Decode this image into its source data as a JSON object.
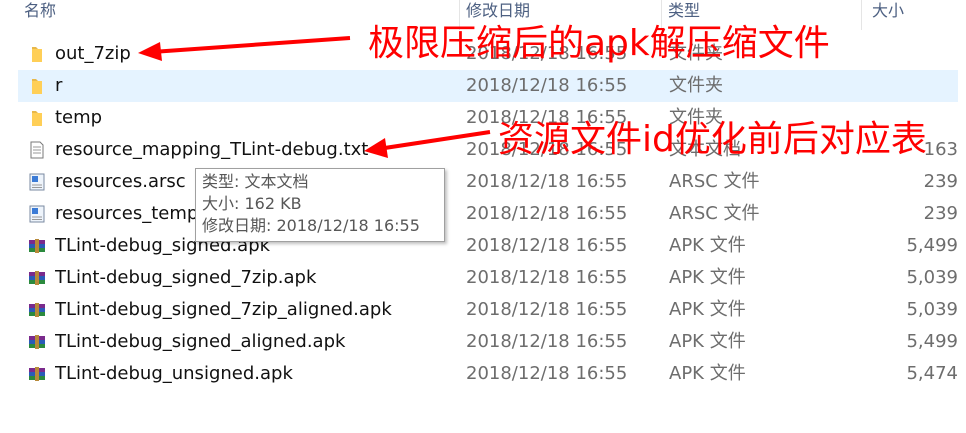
{
  "columns": {
    "name": "名称",
    "date": "修改日期",
    "type": "类型",
    "size": "大小"
  },
  "rows": [
    {
      "name": "out_7zip",
      "date": "2018/12/18 16:55",
      "type": "文件夹",
      "size": "",
      "icon": "folder-icon"
    },
    {
      "name": "r",
      "date": "2018/12/18 16:55",
      "type": "文件夹",
      "size": "",
      "icon": "folder-icon",
      "selected": true
    },
    {
      "name": "temp",
      "date": "2018/12/18 16:55",
      "type": "文件夹",
      "size": "",
      "icon": "folder-icon"
    },
    {
      "name": "resource_mapping_TLint-debug.txt",
      "date": "2018/12/18 16:55",
      "type": "文本文档",
      "size": "163",
      "icon": "text-file-icon"
    },
    {
      "name": "resources.arsc",
      "date": "2018/12/18 16:55",
      "type": "ARSC 文件",
      "size": "239",
      "icon": "arsc-file-icon"
    },
    {
      "name": "resources_temp.arsc",
      "date": "2018/12/18 16:55",
      "type": "ARSC 文件",
      "size": "239",
      "icon": "arsc-file-icon"
    },
    {
      "name": "TLint-debug_signed.apk",
      "date": "2018/12/18 16:55",
      "type": "APK 文件",
      "size": "5,499",
      "icon": "apk-archive-icon"
    },
    {
      "name": "TLint-debug_signed_7zip.apk",
      "date": "2018/12/18 16:55",
      "type": "APK 文件",
      "size": "5,039",
      "icon": "apk-archive-icon"
    },
    {
      "name": "TLint-debug_signed_7zip_aligned.apk",
      "date": "2018/12/18 16:55",
      "type": "APK 文件",
      "size": "5,039",
      "icon": "apk-archive-icon"
    },
    {
      "name": "TLint-debug_signed_aligned.apk",
      "date": "2018/12/18 16:55",
      "type": "APK 文件",
      "size": "5,499",
      "icon": "apk-archive-icon"
    },
    {
      "name": "TLint-debug_unsigned.apk",
      "date": "2018/12/18 16:55",
      "type": "APK 文件",
      "size": "5,474",
      "icon": "apk-archive-icon"
    }
  ],
  "tooltip": {
    "type_line": "类型: 文本文档",
    "size_line": "大小: 162 KB",
    "date_line": "修改日期: 2018/12/18 16:55"
  },
  "annotations": {
    "apk_unzip": "极限压缩后的apk解压缩文件",
    "resource_id_table": "资源文件id优化前后对应表"
  },
  "colors": {
    "annotation": "#ff0000",
    "selection": "#e5f3ff",
    "header_text": "#4d6082"
  }
}
